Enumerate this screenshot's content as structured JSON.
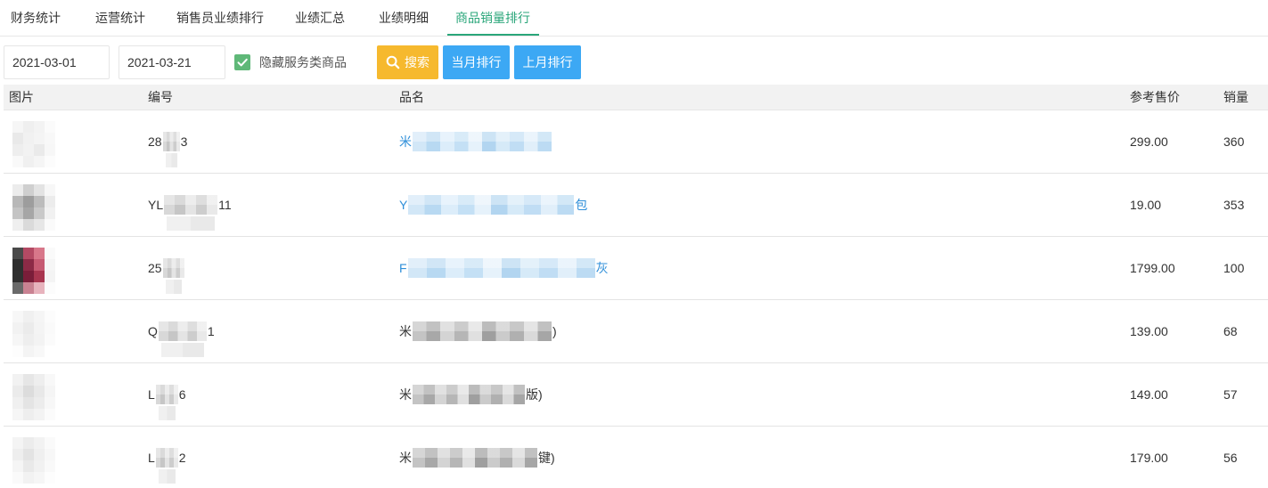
{
  "tabs": [
    {
      "label": "财务统计",
      "active": false
    },
    {
      "label": "运营统计",
      "active": false
    },
    {
      "label": "销售员业绩排行",
      "active": false
    },
    {
      "label": "业绩汇总",
      "active": false
    },
    {
      "label": "业绩明细",
      "active": false
    },
    {
      "label": "商品销量排行",
      "active": true
    }
  ],
  "filters": {
    "start_date": "2021-03-01",
    "end_date": "2021-03-21",
    "hide_service_checked": true,
    "hide_service_label": "隐藏服务类商品",
    "check_icon": "check-icon",
    "search_icon": "search-icon",
    "search_label": "搜索",
    "this_month_label": "当月排行",
    "last_month_label": "上月排行"
  },
  "table": {
    "columns": {
      "image": "图片",
      "code": "编号",
      "name": "品名",
      "price": "参考售价",
      "sales": "销量"
    },
    "rows": [
      {
        "code_start": "28",
        "code_end": "3",
        "name_start": "米",
        "price": "299.00",
        "sales": "360",
        "image_mosaic": [
          "#f6f6f6",
          "#efefef",
          "#f3f3f3",
          "#fbfbfb",
          "#e9e9e9",
          "#f1f1f1",
          "#f4f4f4",
          "#f8f8f8",
          "#eeeeee",
          "#f2f2f2",
          "#eaeaea",
          "#f7f7f7",
          "#f9f9f9",
          "#f0f0f0",
          "#f5f5f5",
          "#fcfcfc"
        ]
      },
      {
        "code_start": "YL",
        "code_end": "11",
        "name_start": "Y",
        "name_end": "包",
        "price": "19.00",
        "sales": "353",
        "image_mosaic": [
          "#ececec",
          "#cfcfcf",
          "#e3e3e3",
          "#f7f7f7",
          "#b8b8b8",
          "#9d9d9d",
          "#bcbcbc",
          "#ececec",
          "#c4c4c4",
          "#a6a6a6",
          "#c9c9c9",
          "#f1f1f1",
          "#efefef",
          "#dadada",
          "#e6e6e6",
          "#fafafa"
        ]
      },
      {
        "code_start": "25",
        "name_start": "F",
        "name_end": "灰",
        "price": "1799.00",
        "sales": "100",
        "image_mosaic": [
          "#4a4a4a",
          "#b44a64",
          "#d8778a",
          "#fafafa",
          "#2e2e2e",
          "#8c2a46",
          "#c65a72",
          "#f6f6f6",
          "#303030",
          "#7a1d39",
          "#a8354f",
          "#f4f4f4",
          "#6a6a6a",
          "#c98292",
          "#e7b3bd",
          "#fcfcfc"
        ]
      },
      {
        "code_start": "Q",
        "code_end": "1",
        "name_start": "米",
        "name_end": ")",
        "price": "139.00",
        "sales": "68",
        "image_mosaic": [
          "#f7f7f7",
          "#f0f0f0",
          "#f5f5f5",
          "#fcfcfc",
          "#f2f2f2",
          "#ebebeb",
          "#f4f4f4",
          "#fafafa",
          "#f6f6f6",
          "#eeeeee",
          "#f3f3f3",
          "#fbfbfb",
          "#fdfdfd",
          "#f4f4f4",
          "#f8f8f8",
          "#ffffff"
        ]
      },
      {
        "code_start": "L",
        "code_end": "6",
        "name_start": "米",
        "name_end": "版)",
        "price": "149.00",
        "sales": "57",
        "image_mosaic": [
          "#f2f2f2",
          "#e6e6e6",
          "#eeeeee",
          "#f8f8f8",
          "#ebebeb",
          "#dcdcdc",
          "#e8e8e8",
          "#f5f5f5",
          "#f0f0f0",
          "#e4e4e4",
          "#ececec",
          "#f7f7f7",
          "#f6f6f6",
          "#eeeeee",
          "#f3f3f3",
          "#fbfbfb"
        ]
      },
      {
        "code_start": "L",
        "code_end": "2",
        "name_start": "米",
        "name_end": "键)",
        "price": "179.00",
        "sales": "56",
        "image_mosaic": [
          "#f4f4f4",
          "#ececec",
          "#f2f2f2",
          "#fafafa",
          "#eeeeee",
          "#e3e3e3",
          "#efefef",
          "#f7f7f7",
          "#f5f5f5",
          "#e9e9e9",
          "#f1f1f1",
          "#f9f9f9",
          "#fafafa",
          "#f2f2f2",
          "#f6f6f6",
          "#fdfdfd"
        ]
      }
    ]
  },
  "theme": {
    "active_tab": "#2aa67a",
    "checkbox": "#5fb878",
    "warm_button": "#f6b92e",
    "normal_button": "#3ca8f4",
    "link": "#2f8fd9"
  }
}
